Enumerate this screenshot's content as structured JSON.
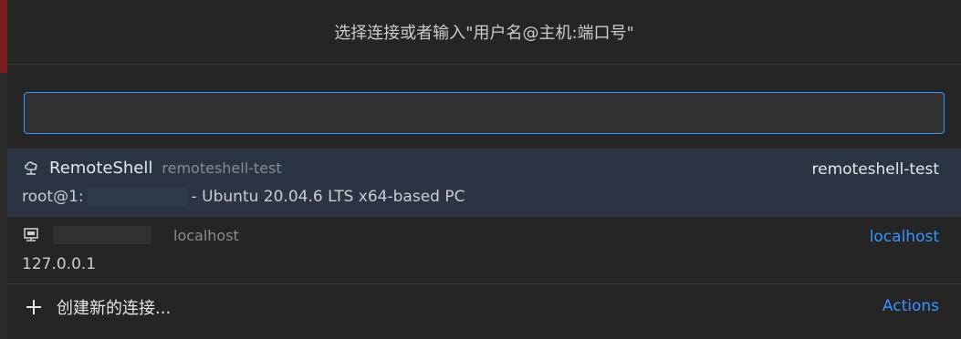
{
  "title": "选择连接或者输入\"用户名@主机:端口号\"",
  "search": {
    "value": "",
    "placeholder": ""
  },
  "items": [
    {
      "name": "RemoteShell",
      "description": "remoteshell-test",
      "detail_prefix": "root@1:",
      "detail_suffix": " - Ubuntu 20.04.6 LTS x64-based PC",
      "right_label": "remoteshell-test",
      "icon": "cloud-icon"
    },
    {
      "name": "",
      "description": "localhost",
      "detail_prefix": "127.0.0.1",
      "right_label": "localhost",
      "icon": "computer-icon"
    }
  ],
  "create": {
    "label": "创建新的连接...",
    "actions_label": "Actions",
    "icon": "plus-icon"
  },
  "colors": {
    "accent": "#3794ff",
    "background": "#252526",
    "selected_background": "#2b3443"
  }
}
